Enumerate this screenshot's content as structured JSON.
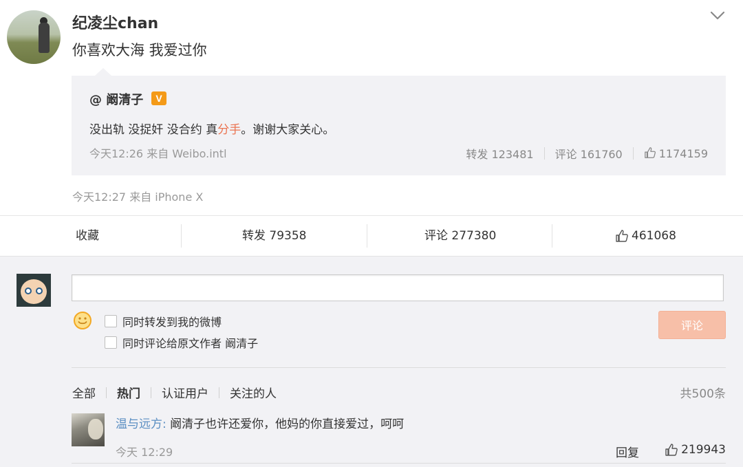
{
  "post": {
    "author": "纪凌尘chan",
    "text": "你喜欢大海 我爱过你",
    "meta": "今天12:27 来自 iPhone X",
    "icons": {
      "avatar": "user-avatar",
      "caret": "chevron-down-icon"
    }
  },
  "repost": {
    "author": "@ 阚清子",
    "badge": "V",
    "text_before": "没出轨 没捉奸 没合约 真",
    "text_highlight": "分手",
    "text_after": "。谢谢大家关心。",
    "meta": "今天12:26 来自 Weibo.intl",
    "forward": "转发 123481",
    "comment": "评论  161760",
    "likes": "1174159",
    "colors": {
      "highlight": "#eb7350",
      "badge": "#f49a18"
    }
  },
  "actions": {
    "favorite": "收藏",
    "forward": "转发 79358",
    "comment": "评论 277380",
    "likes": "461068"
  },
  "comment_box": {
    "input_value": "",
    "option1": "同时转发到我的微博",
    "option2": "同时评论给原文作者 阚清子",
    "submit": "评论"
  },
  "filters": {
    "items": [
      "全部",
      "热门",
      "认证用户",
      "关注的人"
    ],
    "active": "热门",
    "total": "共500条"
  },
  "comments": [
    {
      "user": "温与远方:",
      "text": " 阚清子也许还爱你，他妈的你直接爱过，呵呵",
      "time": "今天 12:29",
      "reply": "回复",
      "likes": "219943"
    }
  ]
}
